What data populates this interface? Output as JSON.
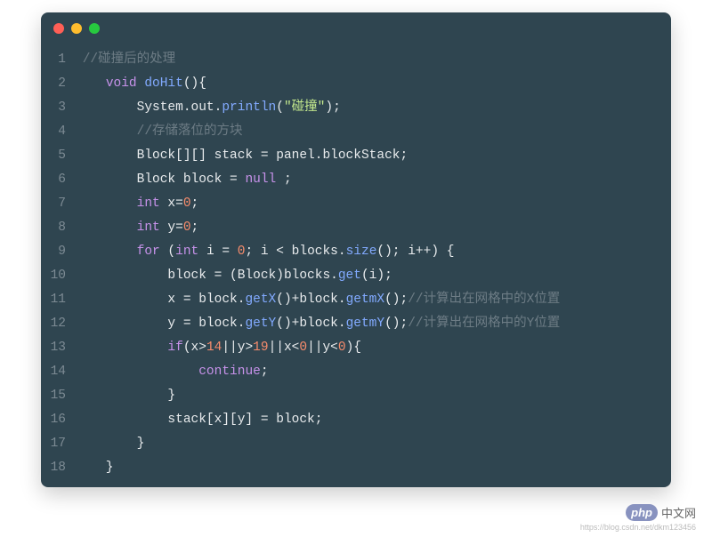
{
  "code": {
    "lines": [
      {
        "n": 1,
        "tokens": [
          {
            "t": " ",
            "c": ""
          },
          {
            "t": "//碰撞后的处理",
            "c": "tok-comment"
          }
        ]
      },
      {
        "n": 2,
        "tokens": [
          {
            "t": "    ",
            "c": ""
          },
          {
            "t": "void",
            "c": "tok-keyword"
          },
          {
            "t": " ",
            "c": ""
          },
          {
            "t": "doHit",
            "c": "tok-method"
          },
          {
            "t": "(){",
            "c": ""
          }
        ]
      },
      {
        "n": 3,
        "tokens": [
          {
            "t": "        System.",
            "c": ""
          },
          {
            "t": "out",
            "c": "tok-field"
          },
          {
            "t": ".",
            "c": ""
          },
          {
            "t": "println",
            "c": "tok-method"
          },
          {
            "t": "(",
            "c": ""
          },
          {
            "t": "\"碰撞\"",
            "c": "tok-string"
          },
          {
            "t": ");",
            "c": ""
          }
        ]
      },
      {
        "n": 4,
        "tokens": [
          {
            "t": "        ",
            "c": ""
          },
          {
            "t": "//存储落位的方块",
            "c": "tok-comment"
          }
        ]
      },
      {
        "n": 5,
        "tokens": [
          {
            "t": "        Block[][] stack = panel.",
            "c": ""
          },
          {
            "t": "blockStack",
            "c": "tok-field"
          },
          {
            "t": ";",
            "c": ""
          }
        ]
      },
      {
        "n": 6,
        "tokens": [
          {
            "t": "        Block block = ",
            "c": ""
          },
          {
            "t": "null",
            "c": "tok-keyword"
          },
          {
            "t": " ;",
            "c": ""
          }
        ]
      },
      {
        "n": 7,
        "tokens": [
          {
            "t": "        ",
            "c": ""
          },
          {
            "t": "int",
            "c": "tok-keyword"
          },
          {
            "t": " x=",
            "c": ""
          },
          {
            "t": "0",
            "c": "tok-number"
          },
          {
            "t": ";",
            "c": ""
          }
        ]
      },
      {
        "n": 8,
        "tokens": [
          {
            "t": "        ",
            "c": ""
          },
          {
            "t": "int",
            "c": "tok-keyword"
          },
          {
            "t": " y=",
            "c": ""
          },
          {
            "t": "0",
            "c": "tok-number"
          },
          {
            "t": ";",
            "c": ""
          }
        ]
      },
      {
        "n": 9,
        "tokens": [
          {
            "t": "        ",
            "c": ""
          },
          {
            "t": "for",
            "c": "tok-keyword"
          },
          {
            "t": " (",
            "c": ""
          },
          {
            "t": "int",
            "c": "tok-keyword"
          },
          {
            "t": " i = ",
            "c": ""
          },
          {
            "t": "0",
            "c": "tok-number"
          },
          {
            "t": "; i < blocks.",
            "c": ""
          },
          {
            "t": "size",
            "c": "tok-method"
          },
          {
            "t": "(); i++) {",
            "c": ""
          }
        ]
      },
      {
        "n": 10,
        "tokens": [
          {
            "t": "            block = (Block)blocks.",
            "c": ""
          },
          {
            "t": "get",
            "c": "tok-method"
          },
          {
            "t": "(i);",
            "c": ""
          }
        ]
      },
      {
        "n": 11,
        "tokens": [
          {
            "t": "            x = block.",
            "c": ""
          },
          {
            "t": "getX",
            "c": "tok-method"
          },
          {
            "t": "()+block.",
            "c": ""
          },
          {
            "t": "getmX",
            "c": "tok-method"
          },
          {
            "t": "();",
            "c": ""
          },
          {
            "t": "//计算出在网格中的X位置",
            "c": "tok-comment"
          }
        ]
      },
      {
        "n": 12,
        "tokens": [
          {
            "t": "            y = block.",
            "c": ""
          },
          {
            "t": "getY",
            "c": "tok-method"
          },
          {
            "t": "()+block.",
            "c": ""
          },
          {
            "t": "getmY",
            "c": "tok-method"
          },
          {
            "t": "();",
            "c": ""
          },
          {
            "t": "//计算出在网格中的Y位置",
            "c": "tok-comment"
          }
        ]
      },
      {
        "n": 13,
        "tokens": [
          {
            "t": "            ",
            "c": ""
          },
          {
            "t": "if",
            "c": "tok-keyword"
          },
          {
            "t": "(x>",
            "c": ""
          },
          {
            "t": "14",
            "c": "tok-number"
          },
          {
            "t": "||y>",
            "c": ""
          },
          {
            "t": "19",
            "c": "tok-number"
          },
          {
            "t": "||x<",
            "c": ""
          },
          {
            "t": "0",
            "c": "tok-number"
          },
          {
            "t": "||y<",
            "c": ""
          },
          {
            "t": "0",
            "c": "tok-number"
          },
          {
            "t": "){",
            "c": ""
          }
        ]
      },
      {
        "n": 14,
        "tokens": [
          {
            "t": "                ",
            "c": ""
          },
          {
            "t": "continue",
            "c": "tok-keyword"
          },
          {
            "t": ";",
            "c": ""
          }
        ]
      },
      {
        "n": 15,
        "tokens": [
          {
            "t": "            }",
            "c": ""
          }
        ]
      },
      {
        "n": 16,
        "tokens": [
          {
            "t": "            stack[x][y] = block;",
            "c": ""
          }
        ]
      },
      {
        "n": 17,
        "tokens": [
          {
            "t": "        }",
            "c": ""
          }
        ]
      },
      {
        "n": 18,
        "tokens": [
          {
            "t": "    }",
            "c": ""
          }
        ]
      }
    ]
  },
  "watermark": {
    "badge": "php",
    "text": "中文网",
    "url": "https://blog.csdn.net/dkm123456"
  }
}
